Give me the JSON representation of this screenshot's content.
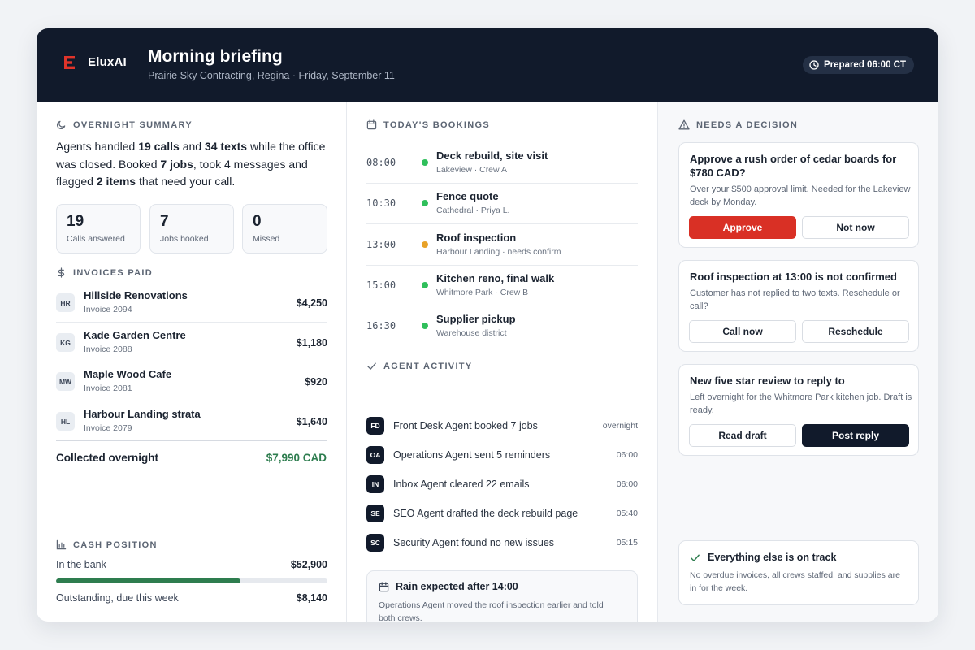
{
  "brand": {
    "name": "EluxAI",
    "accent": "#d93025"
  },
  "header": {
    "title": "Morning briefing",
    "subtitle": "Prairie Sky Contracting, Regina · Friday, September 11",
    "prepared": "Prepared 06:00 CT"
  },
  "overnight": {
    "heading": "OVERNIGHT SUMMARY",
    "summary_parts": [
      "Agents handled ",
      "19 calls",
      " and ",
      "34 texts",
      " while the office was closed. Booked ",
      "7 jobs",
      ", took 4 messages and flagged ",
      "2 items",
      " that need your call."
    ],
    "stats": [
      {
        "value": "19",
        "label": "Calls answered"
      },
      {
        "value": "7",
        "label": "Jobs booked"
      },
      {
        "value": "0",
        "label": "Missed"
      }
    ]
  },
  "invoices": {
    "heading": "INVOICES PAID",
    "items": [
      {
        "initials": "HR",
        "name": "Hillside Renovations",
        "invoice": "Invoice 2094",
        "amount": "$4,250"
      },
      {
        "initials": "KG",
        "name": "Kade Garden Centre",
        "invoice": "Invoice 2088",
        "amount": "$1,180"
      },
      {
        "initials": "MW",
        "name": "Maple Wood Cafe",
        "invoice": "Invoice 2081",
        "amount": "$920"
      },
      {
        "initials": "HL",
        "name": "Harbour Landing strata",
        "invoice": "Invoice 2079",
        "amount": "$1,640"
      }
    ],
    "collected_label": "Collected overnight",
    "collected_amount": "$7,990 CAD"
  },
  "cash": {
    "heading": "CASH POSITION",
    "bank_label": "In the bank",
    "bank_amount": "$52,900",
    "bar_fraction": 0.68,
    "outstanding_label": "Outstanding, due this week",
    "outstanding_amount": "$8,140"
  },
  "bookings": {
    "heading": "TODAY'S BOOKINGS",
    "items": [
      {
        "time": "08:00",
        "title": "Deck rebuild, site visit",
        "sub": "Lakeview · Crew A",
        "status_color": "#2fbf5b"
      },
      {
        "time": "10:30",
        "title": "Fence quote",
        "sub": "Cathedral · Priya L.",
        "status_color": "#2fbf5b"
      },
      {
        "time": "13:00",
        "title": "Roof inspection",
        "sub": "Harbour Landing · needs confirm",
        "status_color": "#e8a228"
      },
      {
        "time": "15:00",
        "title": "Kitchen reno, final walk",
        "sub": "Whitmore Park · Crew B",
        "status_color": "#2fbf5b"
      },
      {
        "time": "16:30",
        "title": "Supplier pickup",
        "sub": "Warehouse district",
        "status_color": "#2fbf5b"
      }
    ]
  },
  "activity": {
    "heading": "AGENT ACTIVITY",
    "items": [
      {
        "badge": "FD",
        "text": "Front Desk Agent booked 7 jobs",
        "time": "overnight"
      },
      {
        "badge": "OA",
        "text": "Operations Agent sent 5 reminders",
        "time": "06:00"
      },
      {
        "badge": "IN",
        "text": "Inbox Agent cleared 22 emails",
        "time": "06:00"
      },
      {
        "badge": "SE",
        "text": "SEO Agent drafted the deck rebuild page",
        "time": "05:40"
      },
      {
        "badge": "SC",
        "text": "Security Agent found no new issues",
        "time": "05:15"
      }
    ]
  },
  "rain": {
    "title": "Rain expected after 14:00",
    "text": "Operations Agent moved the roof inspection earlier and told both crews."
  },
  "decisions": {
    "heading": "NEEDS A DECISION",
    "cards": [
      {
        "title": "Approve a rush order of cedar boards for $780 CAD?",
        "text": "Over your $500 approval limit. Needed for the Lakeview deck by Monday.",
        "primary": "Approve",
        "secondary": "Not now"
      },
      {
        "title": "Roof inspection at 13:00 is not confirmed",
        "text": "Customer has not replied to two texts. Reschedule or call?",
        "primary": "Call now",
        "secondary": "Reschedule"
      },
      {
        "title": "New five star review to reply to",
        "text": "Left overnight for the Whitmore Park kitchen job. Draft is ready.",
        "primary": "Read draft",
        "secondary": "Post reply"
      }
    ]
  },
  "on_track": {
    "title": "Everything else is on track",
    "text": "No overdue invoices, all crews staffed, and supplies are in for the week."
  }
}
